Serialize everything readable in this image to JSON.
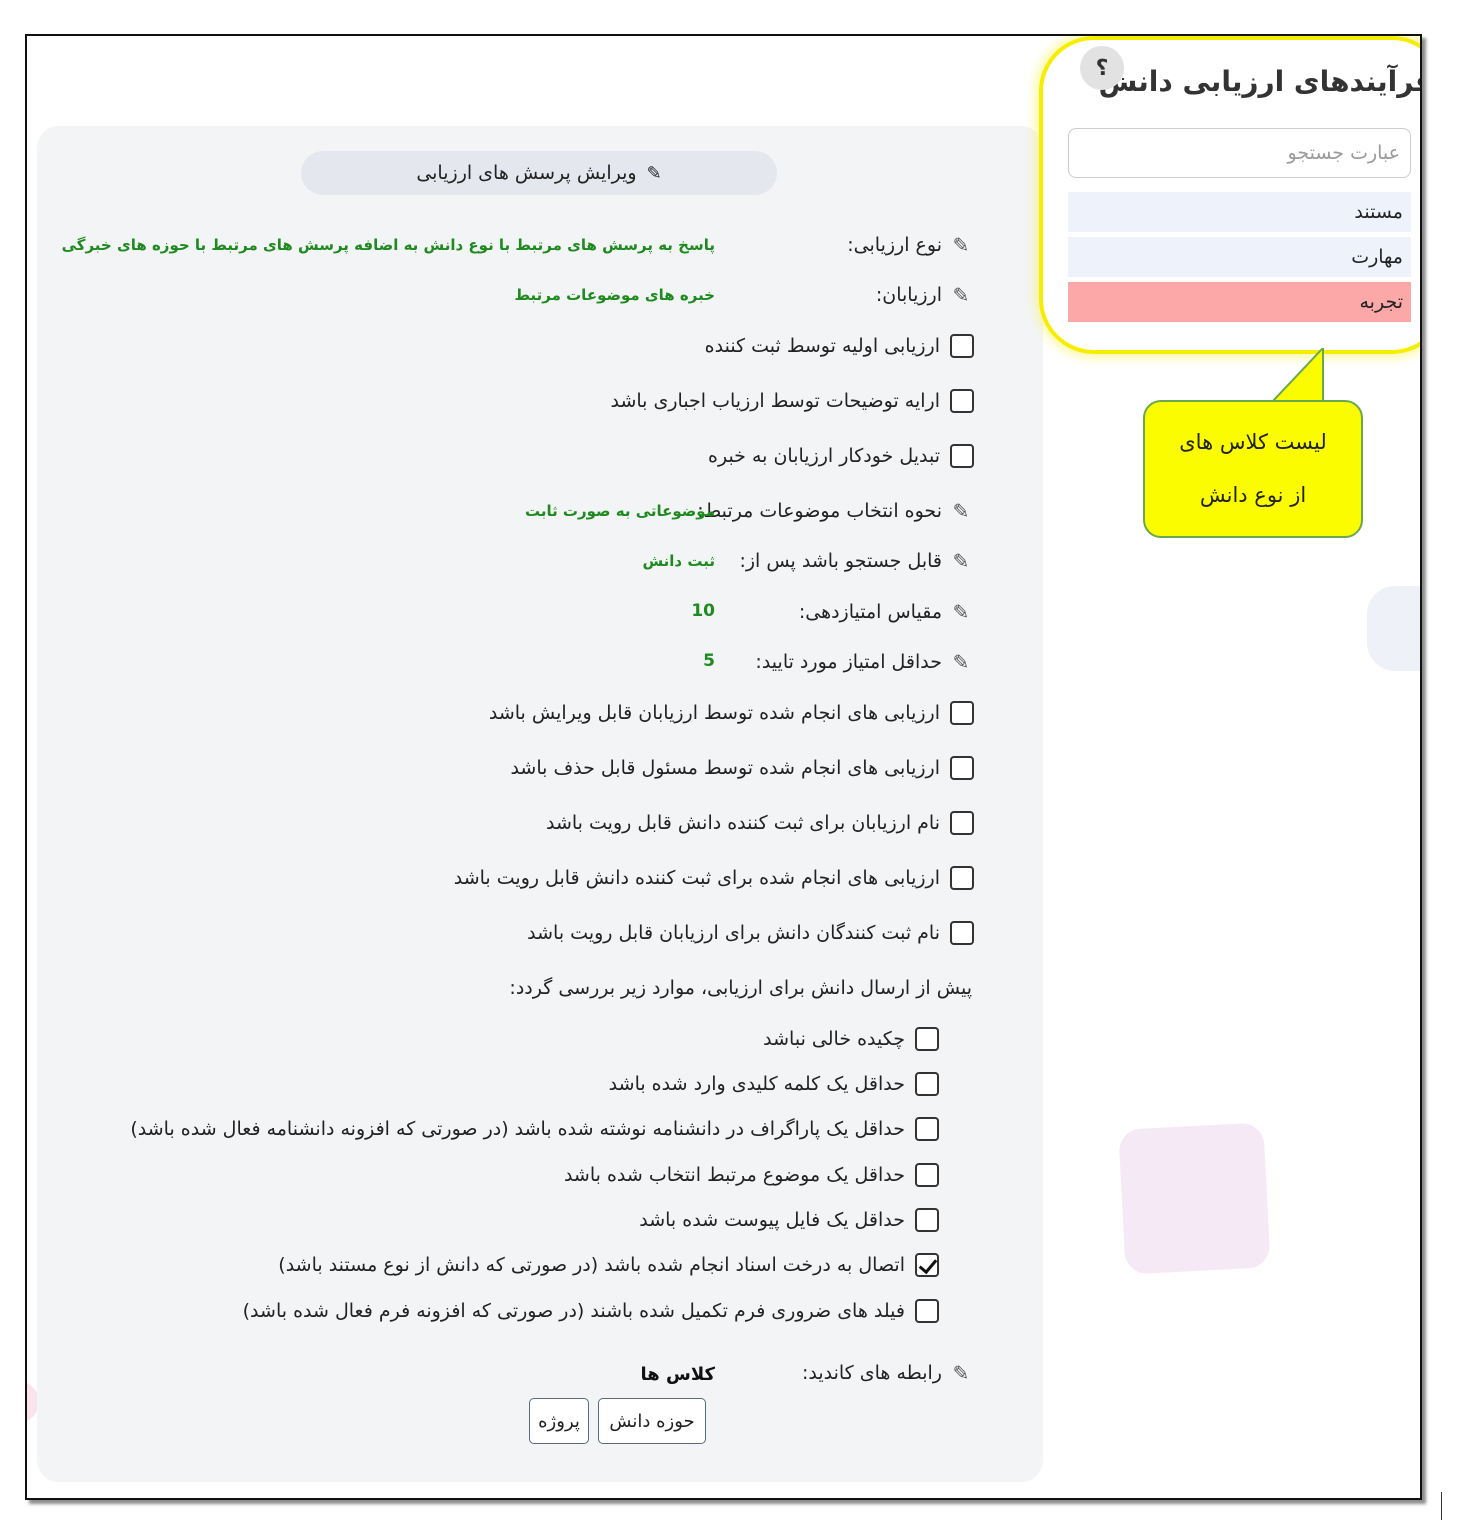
{
  "edit_title": "ویرایش پرسش های ارزیابی",
  "fields": {
    "eval_type_label": "نوع ارزیابی:",
    "eval_type_value": "پاسخ به پرسش های مرتبط با نوع دانش به اضافه پرسش های مرتبط با حوزه های خبرگی",
    "evaluators_label": "ارزیابان:",
    "evaluators_value": "خبره های موضوعات مرتبط",
    "topic_method_label": "نحوه انتخاب موضوعات مرتبط:",
    "topic_method_value": "موضوعاتی به صورت ثابت",
    "searchable_label": "قابل جستجو باشد پس از:",
    "searchable_value": "ثبت دانش",
    "scale_label": "مقیاس امتیازدهی:",
    "scale_value": "10",
    "min_score_label": "حداقل امتیاز مورد تایید:",
    "min_score_value": "5",
    "candidate_label": "رابطه های کاندید:",
    "candidate_value": "کلاس ها"
  },
  "options": {
    "initial_eval": "ارزیابی اولیه توسط ثبت کننده",
    "mandatory_desc": "ارایه توضیحات توسط ارزیاب اجباری باشد",
    "auto_convert": "تبدیل خودکار ارزیابان به خبره",
    "editable": "ارزیابی های انجام شده توسط ارزیابان قابل ویرایش باشد",
    "deletable": "ارزیابی های انجام شده توسط مسئول قابل حذف باشد",
    "evaluator_names_visible": "نام ارزیابان برای ثبت کننده دانش قابل رویت باشد",
    "evaluations_visible": "ارزیابی های انجام شده برای ثبت کننده دانش قابل رویت باشد",
    "submitter_names_visible": "نام ثبت کنندگان دانش برای ارزیابان قابل رویت باشد"
  },
  "pre_check_label": "پیش از ارسال دانش برای ارزیابی، موارد زیر بررسی گردد:",
  "checks": {
    "abstract": "چکیده خالی نباشد",
    "keyword": "حداقل یک کلمه کلیدی وارد شده باشد",
    "paragraph": "حداقل یک پاراگراف در دانشنامه نوشته شده باشد (در صورتی که افزونه دانشنامه فعال شده باشد)",
    "topic": "حداقل یک موضوع مرتبط انتخاب شده باشد",
    "file": "حداقل یک فایل پیوست شده باشد",
    "doc_tree": "اتصال به درخت اسناد انجام شده باشد (در صورتی که دانش از نوع مستند باشد)",
    "form": "فیلد های ضروری فرم تکمیل شده باشند (در صورتی که افزونه فرم فعال شده باشد)"
  },
  "buttons": {
    "knowledge_domain": "حوزه دانش",
    "project": "پروژه"
  },
  "sidebar": {
    "title": "فرآیندهای ارزیابی دانش",
    "help": "؟",
    "search_placeholder": "عبارت جستجو",
    "items": [
      {
        "label": "مستند"
      },
      {
        "label": "مهارت"
      },
      {
        "label": "تجربه"
      }
    ]
  },
  "callout": {
    "line1": "لیست کلاس های",
    "line2": "از نوع دانش"
  },
  "colors": {
    "green_value": "#1f8a1f",
    "active_item": "#fca8a8",
    "highlight": "#f5ee00",
    "callout": "#fcfc00"
  }
}
